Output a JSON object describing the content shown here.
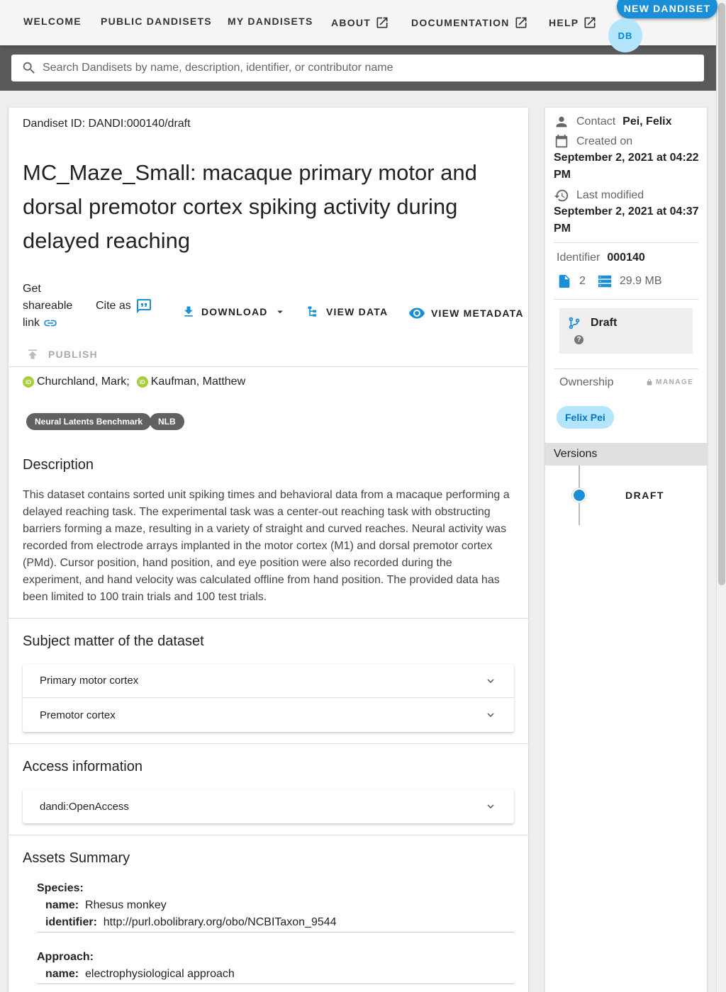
{
  "nav": {
    "items": [
      "WELCOME",
      "PUBLIC DANDISETS",
      "MY DANDISETS",
      "ABOUT",
      "DOCUMENTATION",
      "HELP"
    ],
    "new_button": "NEW DANDISET",
    "avatar": "DB"
  },
  "search": {
    "placeholder": "Search Dandisets by name, description, identifier, or contributor name"
  },
  "dandiset": {
    "id_line": "Dandiset ID: DANDI:000140/draft",
    "title": "MC_Maze_Small: macaque primary motor and dorsal premotor cortex spiking activity during delayed reaching",
    "actions": {
      "share": "Get shareable link",
      "cite": "Cite as",
      "download": "DOWNLOAD",
      "view_data": "VIEW DATA",
      "view_metadata": "VIEW METADATA",
      "publish": "PUBLISH"
    },
    "contributors": [
      "Churchland, Mark;",
      "Kaufman, Matthew"
    ],
    "keywords": [
      "Neural Latents Benchmark",
      "NLB"
    ],
    "description_heading": "Description",
    "description": "This dataset contains sorted unit spiking times and behavioral data from a macaque performing a delayed reaching task. The experimental task was a center-out reaching task with obstructing barriers forming a maze, resulting in a variety of straight and curved reaches. Neural activity was recorded from electrode arrays implanted in the motor cortex (M1) and dorsal premotor cortex (PMd). Cursor position, hand position, and eye position were also recorded during the experiment, and hand velocity was calculated offline from hand position. The provided data has been limited to 100 train trials and 100 test trials.",
    "subject_heading": "Subject matter of the dataset",
    "subjects": [
      "Primary motor cortex",
      "Premotor cortex"
    ],
    "access_heading": "Access information",
    "access": [
      "dandi:OpenAccess"
    ],
    "assets_heading": "Assets Summary",
    "assets": {
      "species_label": "Species:",
      "species_name_key": "name:",
      "species_name": "Rhesus monkey",
      "species_id_key": "identifier:",
      "species_id": "http://purl.obolibrary.org/obo/NCBITaxon_9544",
      "approach_label": "Approach:",
      "approach_name_key": "name:",
      "approach_name": "electrophysiological approach"
    }
  },
  "side": {
    "contact_label": "Contact",
    "contact": "Pei, Felix",
    "created_label": "Created on",
    "created": "September 2, 2021 at 04:22 PM",
    "modified_label": "Last modified",
    "modified": "September 2, 2021 at 04:37 PM",
    "identifier_label": "Identifier",
    "identifier": "000140",
    "file_count": "2",
    "size": "29.9 MB",
    "draft": "Draft",
    "help": "?",
    "ownership": "Ownership",
    "manage": "MANAGE",
    "owner": "Felix Pei",
    "versions": "Versions",
    "version_label": "DRAFT"
  },
  "colors": {
    "primary": "#1a8fd8",
    "chip_bg": "#616161",
    "owner_chip": "#b3e5fc",
    "search_band": "#595959"
  }
}
